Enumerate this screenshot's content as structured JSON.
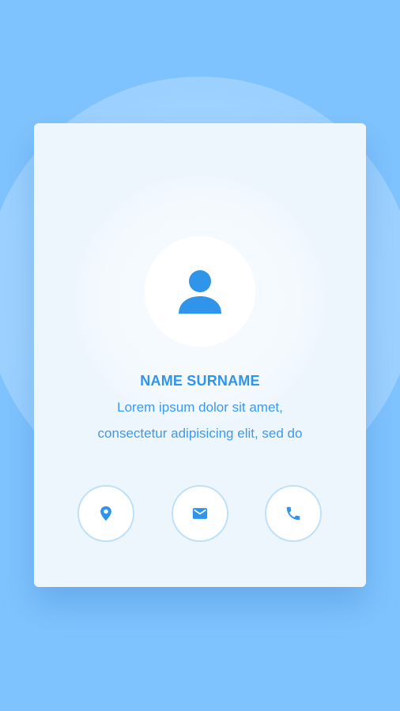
{
  "profile": {
    "name": "NAME SURNAME",
    "description_line1": "Lorem ipsum dolor sit amet,",
    "description_line2": "consectetur adipisicing elit, sed do",
    "avatar_icon": "person-icon"
  },
  "actions": [
    {
      "icon": "location-pin-icon"
    },
    {
      "icon": "envelope-icon"
    },
    {
      "icon": "phone-icon"
    }
  ],
  "colors": {
    "background": "#7fc3fe",
    "card": "#eef6fd",
    "accent": "#2f94ea",
    "button_border": "#bfe0fb"
  }
}
